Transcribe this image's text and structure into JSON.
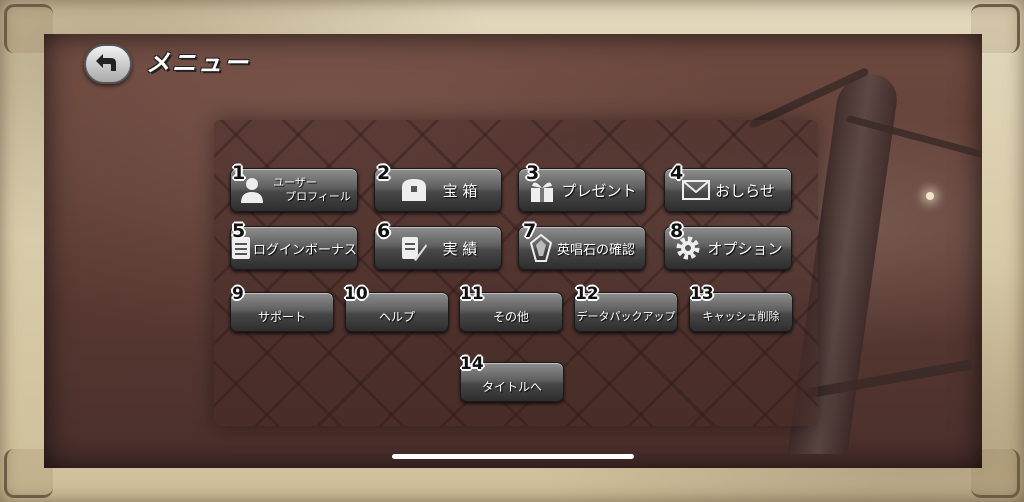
{
  "header": {
    "title": "メニュー",
    "back_icon": "back-arrow-icon"
  },
  "menu": {
    "rows": [
      [
        {
          "number": "1",
          "label_line1": "ユーザー",
          "label_line2": "プロフィール",
          "icon": "user-icon"
        },
        {
          "number": "2",
          "label": "宝 箱",
          "icon": "treasure-chest-icon"
        },
        {
          "number": "3",
          "label": "プレゼント",
          "icon": "gift-icon"
        },
        {
          "number": "4",
          "label": "おしらせ",
          "icon": "envelope-icon"
        }
      ],
      [
        {
          "number": "5",
          "label": "ログインボーナス",
          "icon": "document-icon"
        },
        {
          "number": "6",
          "label": "実 績",
          "icon": "quill-document-icon"
        },
        {
          "number": "7",
          "label": "英唱石の確認",
          "icon": "crystal-icon"
        },
        {
          "number": "8",
          "label": "オプション",
          "icon": "gear-icon"
        }
      ],
      [
        {
          "number": "9",
          "label": "サポート"
        },
        {
          "number": "10",
          "label": "ヘルプ"
        },
        {
          "number": "11",
          "label": "その他"
        },
        {
          "number": "12",
          "label": "データパックアップ"
        },
        {
          "number": "13",
          "label": "キャッシュ削除"
        }
      ],
      [
        {
          "number": "14",
          "label": "タイトルへ"
        }
      ]
    ]
  },
  "colors": {
    "button_top": "#8e8e8e",
    "button_bottom": "#2e2e2e",
    "scene_bg": "#5a3a33",
    "frame_bg": "#d8cba9"
  }
}
